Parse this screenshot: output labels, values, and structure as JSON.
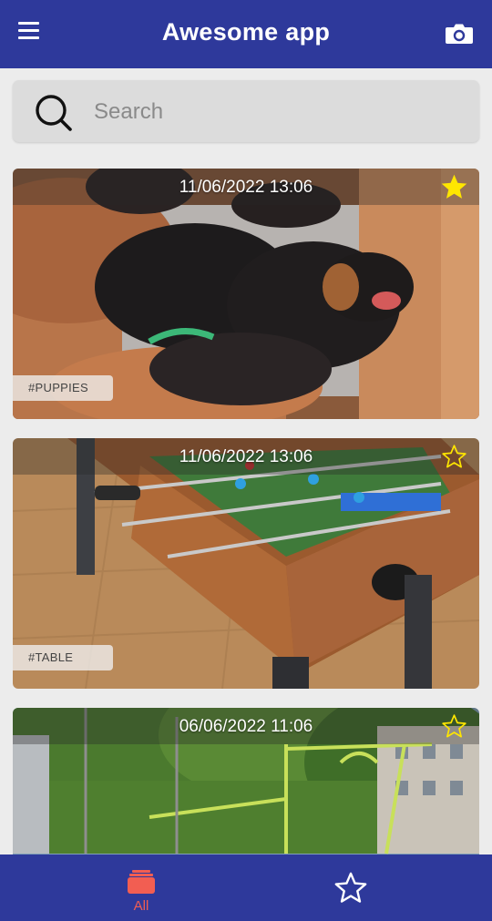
{
  "app": {
    "title": "Awesome app"
  },
  "search": {
    "placeholder": "Search"
  },
  "cards": [
    {
      "datetime": "11/06/2022 13:06",
      "favorite": true,
      "tag": "#PUPPIES"
    },
    {
      "datetime": "11/06/2022 13:06",
      "favorite": false,
      "tag": "#TABLE"
    },
    {
      "datetime": "06/06/2022 11:06",
      "favorite": false,
      "tag": ""
    }
  ],
  "bottom_nav": {
    "all_label": "All"
  },
  "colors": {
    "primary": "#2e399b",
    "active_tab": "#f25e52",
    "star": "#ffe600",
    "search_bg": "#dcdcdc"
  },
  "icons": {
    "menu": "menu-icon",
    "camera": "camera-icon",
    "search": "search-icon",
    "favorite_filled": "star-filled-icon",
    "favorite_outline": "star-outline-icon",
    "all": "stack-icon"
  }
}
